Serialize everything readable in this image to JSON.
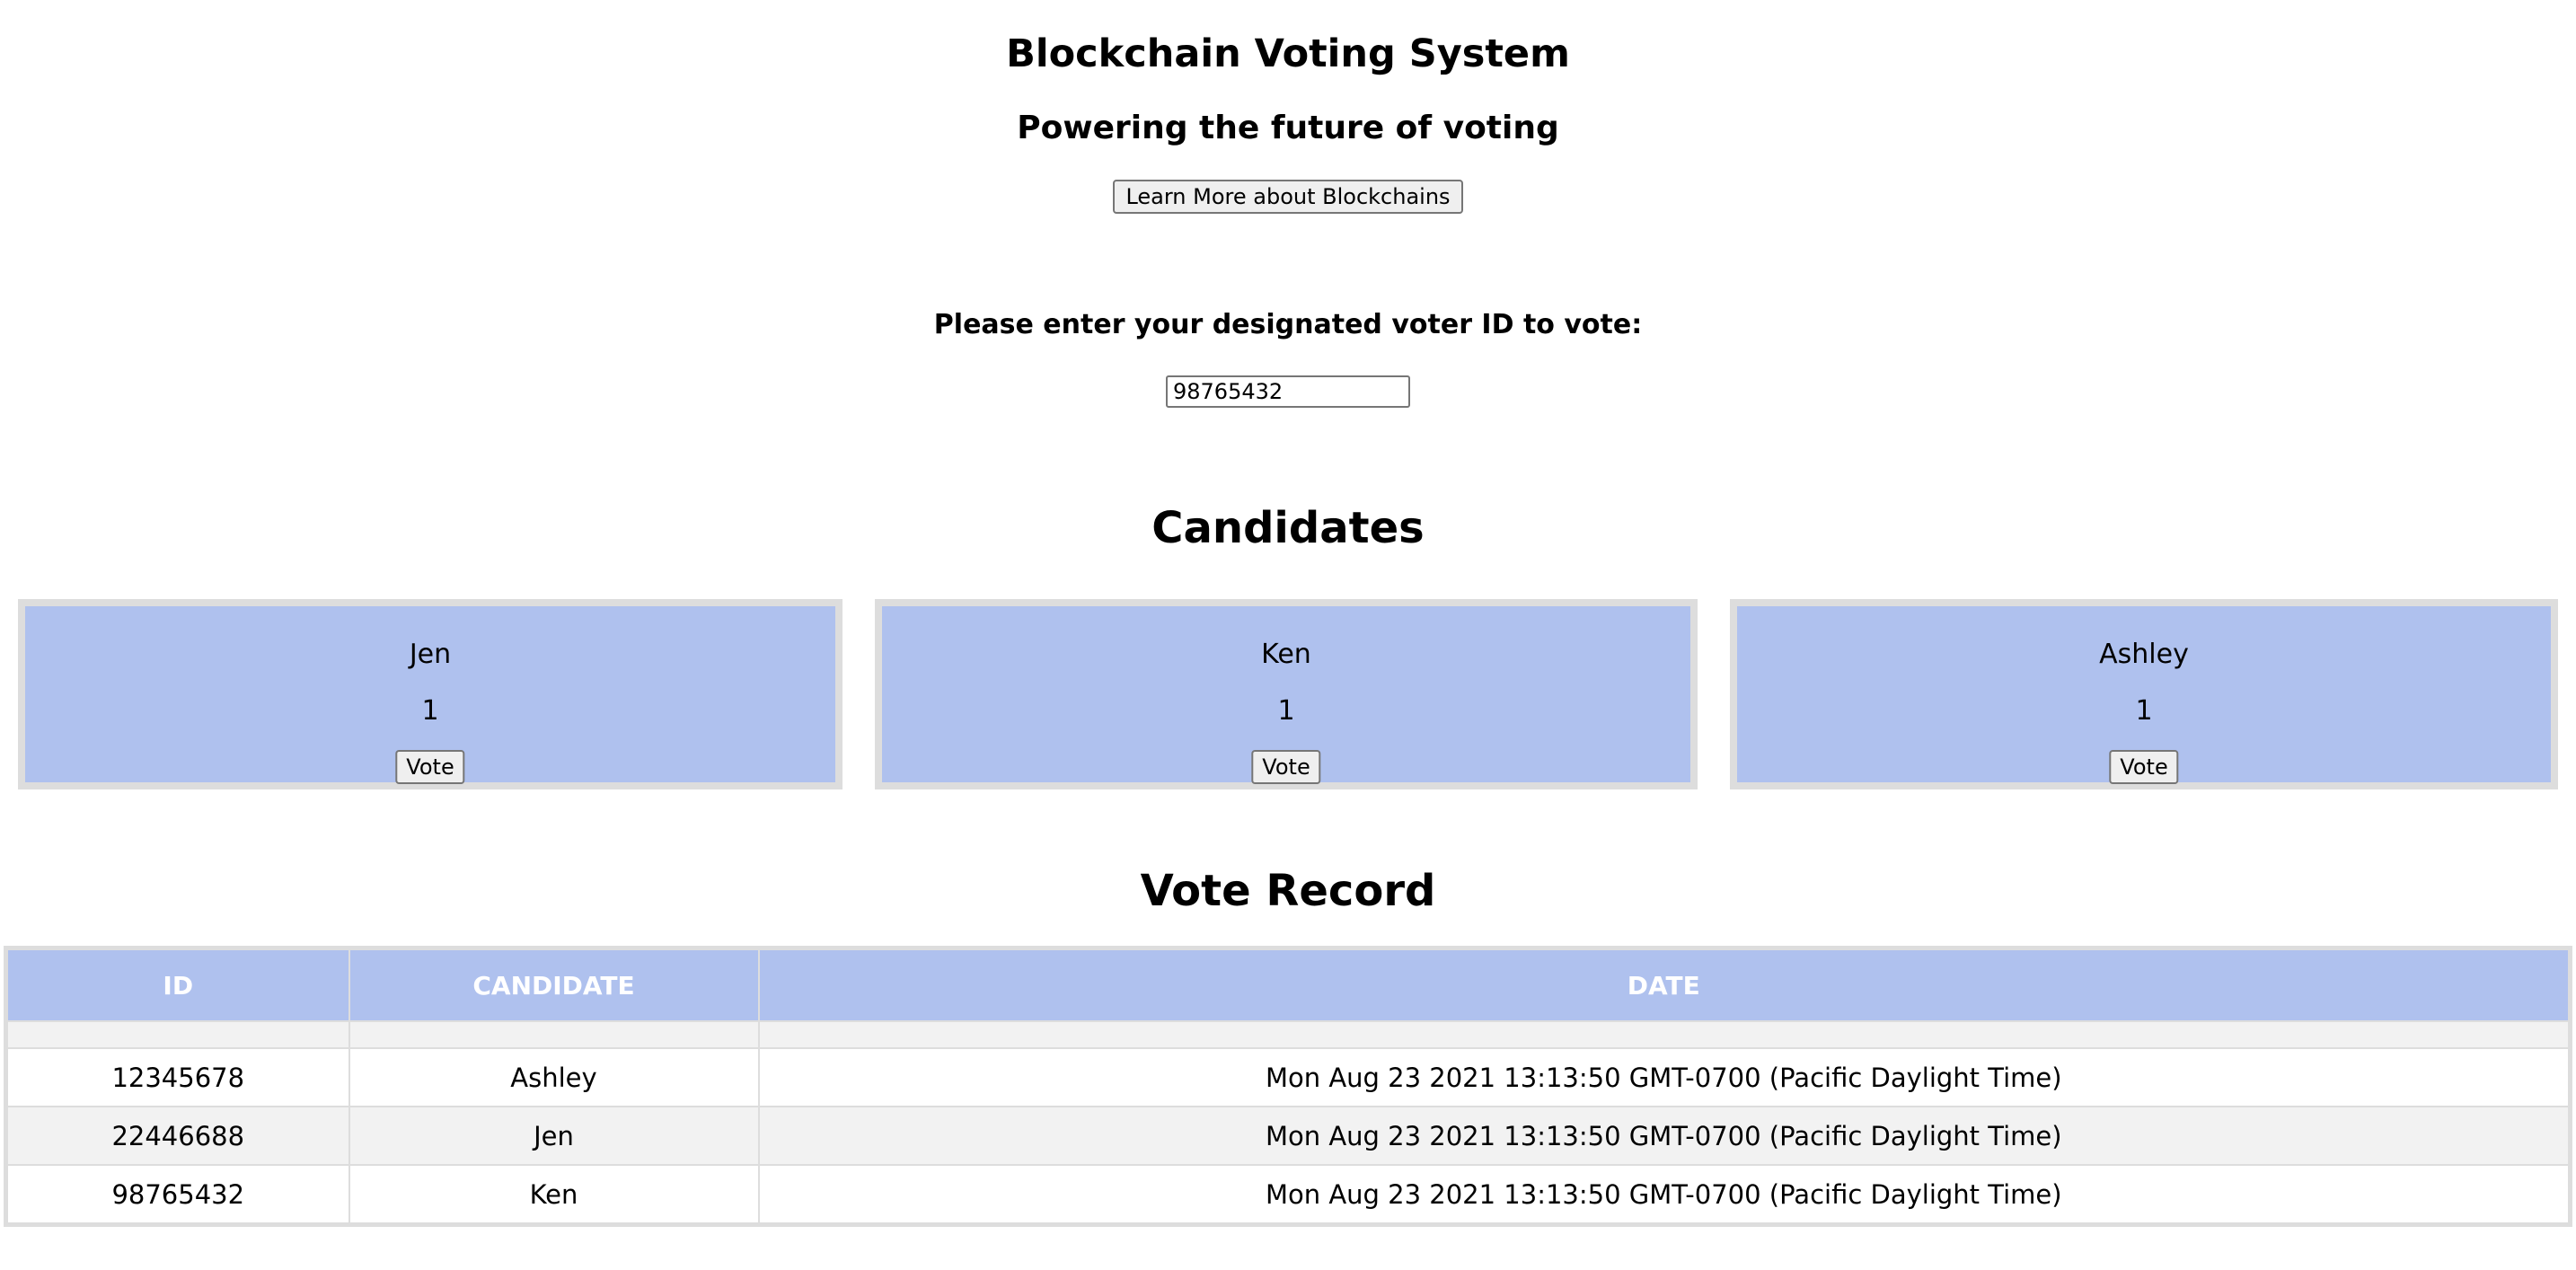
{
  "header": {
    "title": "Blockchain Voting System",
    "subtitle": "Powering the future of voting",
    "learn_button_label": "Learn More about Blockchains"
  },
  "voter": {
    "prompt": "Please enter your designated voter ID to vote:",
    "id_value": "98765432"
  },
  "candidates": {
    "title": "Candidates",
    "vote_label": "Vote",
    "items": [
      {
        "name": "Jen",
        "votes": "1"
      },
      {
        "name": "Ken",
        "votes": "1"
      },
      {
        "name": "Ashley",
        "votes": "1"
      }
    ]
  },
  "record": {
    "title": "Vote Record",
    "columns": [
      "ID",
      "CANDIDATE",
      "DATE"
    ],
    "rows": [
      {
        "id": "12345678",
        "candidate": "Ashley",
        "date": "Mon Aug 23 2021 13:13:50 GMT-0700 (Pacific Daylight Time)"
      },
      {
        "id": "22446688",
        "candidate": "Jen",
        "date": "Mon Aug 23 2021 13:13:50 GMT-0700 (Pacific Daylight Time)"
      },
      {
        "id": "98765432",
        "candidate": "Ken",
        "date": "Mon Aug 23 2021 13:13:50 GMT-0700 (Pacific Daylight Time)"
      }
    ]
  },
  "colors": {
    "card_background": "#afc1ee",
    "card_border": "#dddddd",
    "table_header": "#afc1ee",
    "row_alt": "#f2f2f2"
  }
}
